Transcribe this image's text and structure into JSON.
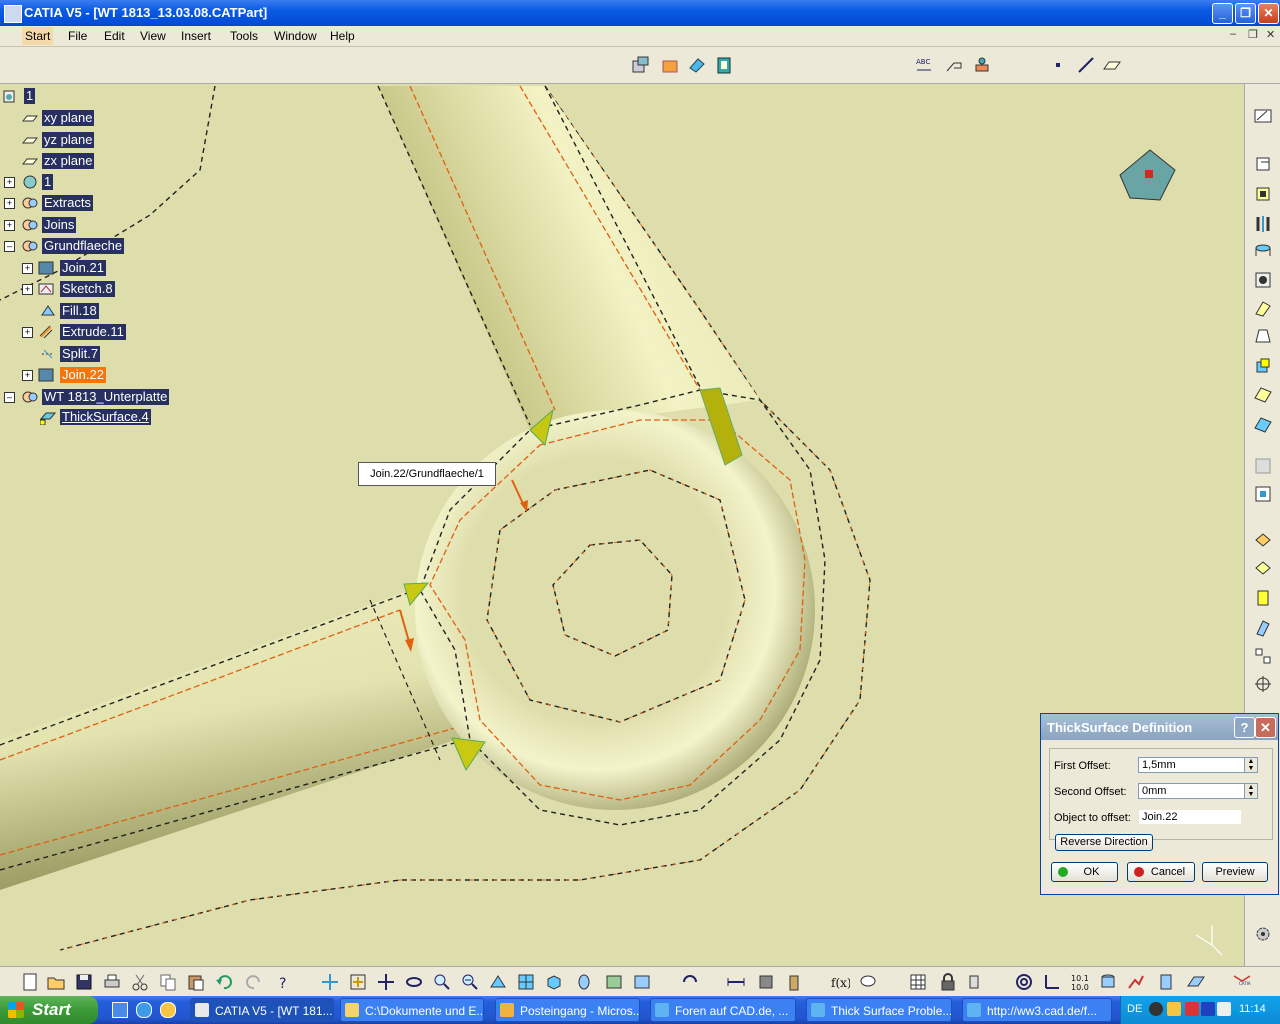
{
  "window": {
    "title": "CATIA V5 - [WT 1813_13.03.08.CATPart]",
    "minimize": "_",
    "restore": "❐",
    "close": "✕"
  },
  "menu": [
    "Start",
    "File",
    "Edit",
    "View",
    "Insert",
    "Tools",
    "Window",
    "Help"
  ],
  "tree": [
    {
      "label": "1",
      "level": 0
    },
    {
      "label": "xy plane",
      "level": 1
    },
    {
      "label": "yz plane",
      "level": 1
    },
    {
      "label": "zx plane",
      "level": 1
    },
    {
      "label": "1",
      "level": 1
    },
    {
      "label": "Extracts",
      "level": 1
    },
    {
      "label": "Joins",
      "level": 1
    },
    {
      "label": "Grundflaeche",
      "level": 1
    },
    {
      "label": "Join.21",
      "level": 2
    },
    {
      "label": "Sketch.8",
      "level": 2
    },
    {
      "label": "Fill.18",
      "level": 2
    },
    {
      "label": "Extrude.11",
      "level": 2
    },
    {
      "label": "Split.7",
      "level": 2
    },
    {
      "label": "Join.22",
      "level": 2
    },
    {
      "label": "WT 1813_Unterplatte",
      "level": 1
    },
    {
      "label": "ThickSurface.4",
      "level": 2
    }
  ],
  "tooltip": "Join.22/Grundflaeche/1",
  "dialog": {
    "title": "ThickSurface Definition",
    "help": "?",
    "close": "✕",
    "first_offset_label": "First Offset:",
    "first_offset_value": "1,5mm",
    "second_offset_label": "Second Offset:",
    "second_offset_value": "0mm",
    "object_label": "Object to offset:",
    "object_value": "Join.22",
    "reverse_label": "Reverse Direction",
    "ok_label": "OK",
    "cancel_label": "Cancel",
    "preview_label": "Preview"
  },
  "taskbar": {
    "start_label": "Start",
    "tasks": [
      "CATIA V5 - [WT 181...",
      "C:\\Dokumente und E...",
      "Posteingang - Micros...",
      "Foren auf CAD.de, ...",
      "Thick Surface Proble...",
      "http://ww3.cad.de/f..."
    ],
    "language": "DE",
    "clock": "11:14"
  },
  "colors": {
    "background": "#dedeac",
    "tree_label": "#27305e",
    "tree_highlight": "#f4750c",
    "edge": "#e06010"
  }
}
